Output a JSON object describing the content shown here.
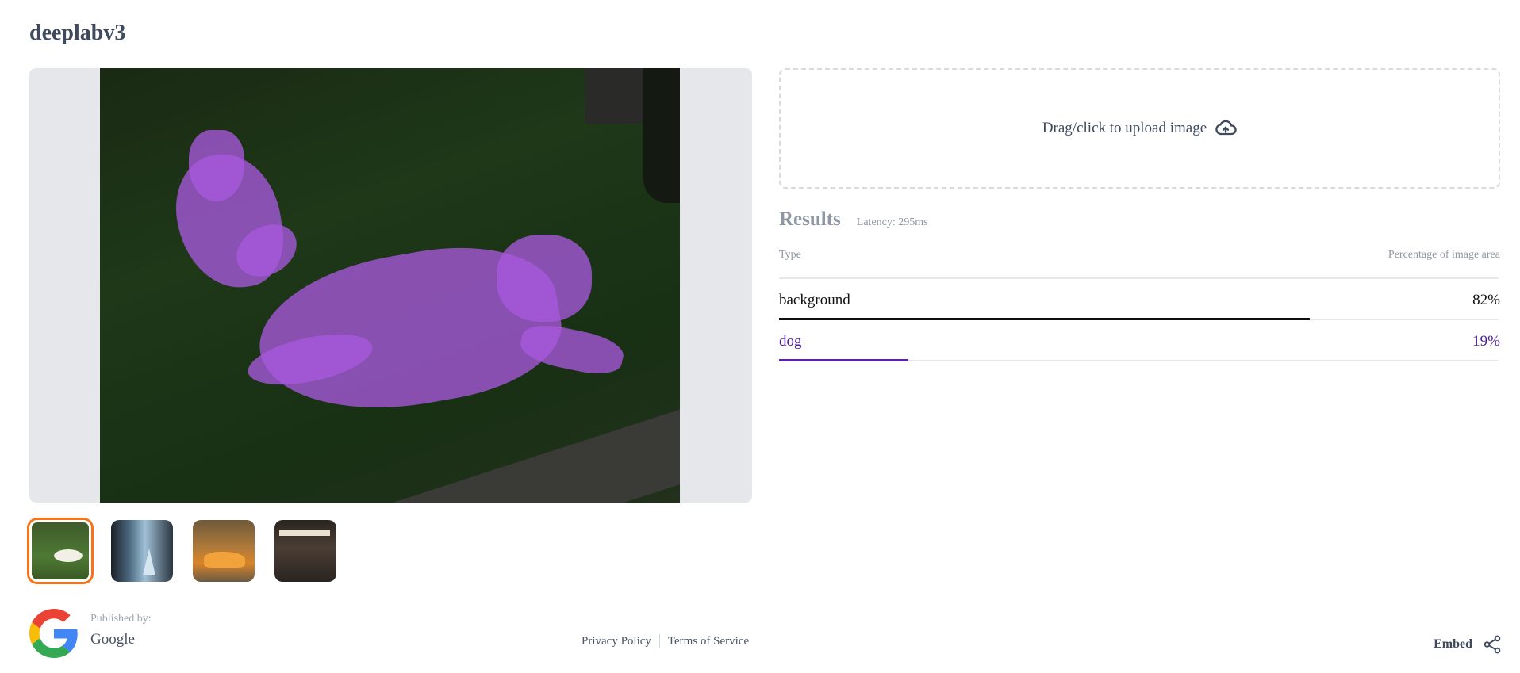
{
  "page": {
    "title": "deeplabv3"
  },
  "upload": {
    "label": "Drag/click to upload image",
    "icon": "upload-cloud-icon"
  },
  "results": {
    "title": "Results",
    "latency": "Latency: 295ms",
    "columns": {
      "type": "Type",
      "percentage": "Percentage of image area"
    },
    "rows": [
      {
        "label": "background",
        "value": "82%",
        "fraction": 0.82,
        "color": "#111111"
      },
      {
        "label": "dog",
        "value": "19%",
        "fraction": 0.19,
        "color": "#5b21b6"
      }
    ]
  },
  "thumbnails": {
    "count": 4,
    "selected_index": 0
  },
  "publisher": {
    "label": "Published by:",
    "name": "Google"
  },
  "footer": {
    "privacy": "Privacy Policy",
    "terms": "Terms of Service"
  },
  "embed": {
    "label": "Embed",
    "icon": "share-icon"
  },
  "colors": {
    "accent_selected": "#f97316",
    "mask": "#a858dc"
  }
}
